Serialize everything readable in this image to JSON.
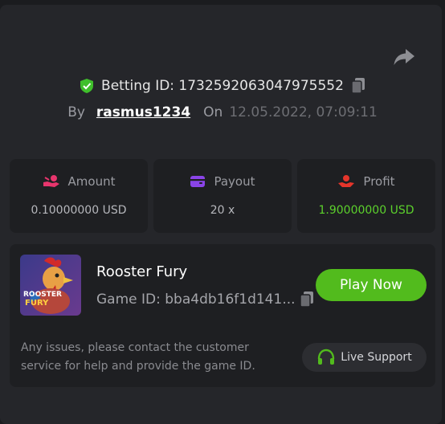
{
  "header": {
    "betting_id": "Betting ID: 1732592063047975552",
    "by_label": "By",
    "username": "rasmus1234",
    "on_label": "On",
    "datetime": "12.05.2022, 07:09:11"
  },
  "stats": [
    {
      "label": "Amount",
      "value": "0.10000000 USD",
      "icon": "coins-hand-icon",
      "color": "#e8356d"
    },
    {
      "label": "Payout",
      "value": "20 x",
      "icon": "wallet-icon",
      "color": "#8a44e8"
    },
    {
      "label": "Profit",
      "value": "1.90000000 USD",
      "icon": "hand-coin-icon",
      "color": "#e5352b"
    }
  ],
  "game": {
    "title": "Rooster Fury",
    "game_id": "Game ID: bba4db16f1d141...",
    "play_label": "Play Now",
    "thumb_text_1": "ROOSTER",
    "thumb_text_2": "FURY"
  },
  "footer": {
    "notice": "Any issues, please contact the customer service for help and provide the game ID.",
    "support_label": "Live Support"
  },
  "colors": {
    "accent_green": "#52bb1d",
    "profit_green": "#5cd12c"
  }
}
